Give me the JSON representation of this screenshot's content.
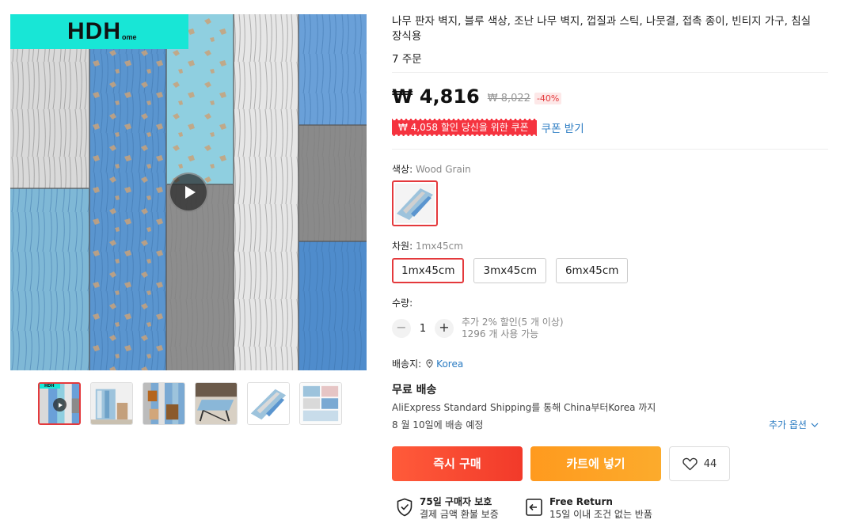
{
  "product": {
    "title": "나무 판자 벽지, 블루 색상, 조난 나무 벽지, 껍질과 스틱, 나뭇결, 접촉 종이, 빈티지 가구, 침실 장식용",
    "orders": "7 주문",
    "price": "₩ 4,816",
    "original_price": "₩ 8,022",
    "discount": "-40%",
    "coupon_label": "₩ 4,058 할인 당신을 위한 쿠폰",
    "coupon_link": "쿠폰 받기"
  },
  "gallery": {
    "logo_main": "HDH",
    "logo_sub": "ome",
    "thumbnails": [
      "video-thumb",
      "room-thumb",
      "wall-thumb",
      "table-thumb",
      "roll-thumb",
      "instructions-thumb"
    ],
    "active_index": 0
  },
  "color": {
    "label": "색상:",
    "value": "Wood Grain"
  },
  "size": {
    "label": "차원:",
    "value": "1mx45cm",
    "options": [
      "1mx45cm",
      "3mx45cm",
      "6mx45cm"
    ],
    "selected_index": 0
  },
  "quantity": {
    "label": "수량:",
    "value": "1",
    "minus": "−",
    "plus": "+",
    "note_line1": "추가 2% 할인(5 개 이상)",
    "note_line2": "1296 개 사용 가능"
  },
  "shipping": {
    "label": "배송지:",
    "destination": "Korea",
    "free": "무료 배송",
    "via": "AliExpress Standard Shipping를 통해 China부터Korea 까지",
    "eta": "8 월 10일에 배송 예정",
    "more": "추가 옵션"
  },
  "actions": {
    "buy_now": "즉시 구매",
    "add_to_cart": "카트에 넣기",
    "wishlist_count": "44"
  },
  "protection": {
    "buyer_title": "75일 구매자 보호",
    "buyer_sub": "결제 금액 환불 보증",
    "return_title": "Free Return",
    "return_sub": "15일 이내 조건 없는 반품"
  },
  "colors": {
    "accent_red": "#e4393c",
    "link_blue": "#2a7bc2",
    "buy_gradient": "#f23a2a",
    "cart_gradient": "#fcab2c",
    "logo_cyan": "#18e6d6"
  }
}
